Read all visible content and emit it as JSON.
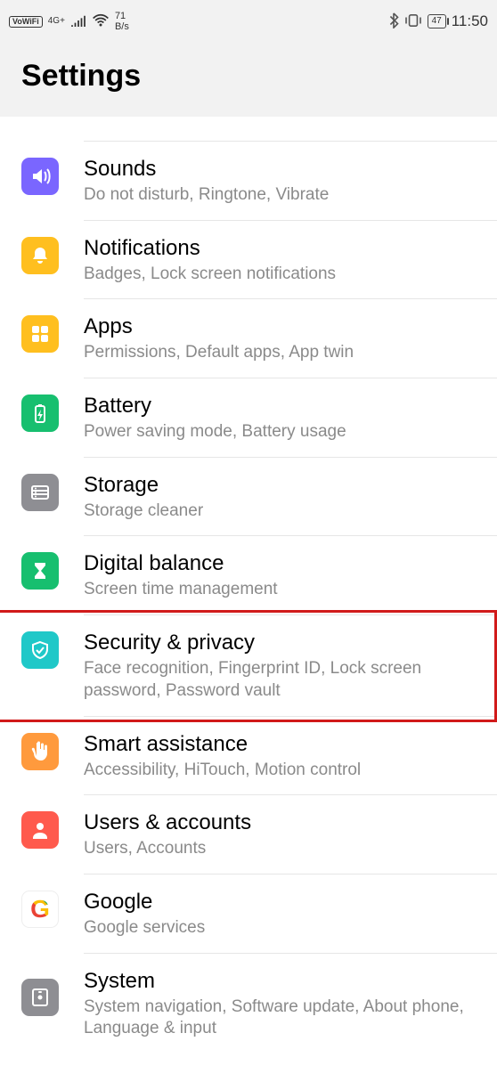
{
  "status": {
    "vowifi": "VoWiFi",
    "net": "4G+",
    "rate_top": "71",
    "rate_bot": "B/s",
    "battery": "47",
    "time": "11:50"
  },
  "header": {
    "title": "Settings"
  },
  "items": {
    "sounds": {
      "title": "Sounds",
      "sub": "Do not disturb, Ringtone, Vibrate"
    },
    "notif": {
      "title": "Notifications",
      "sub": "Badges, Lock screen notifications"
    },
    "apps": {
      "title": "Apps",
      "sub": "Permissions, Default apps, App twin"
    },
    "battery": {
      "title": "Battery",
      "sub": "Power saving mode, Battery usage"
    },
    "storage": {
      "title": "Storage",
      "sub": "Storage cleaner"
    },
    "digbal": {
      "title": "Digital balance",
      "sub": "Screen time management"
    },
    "security": {
      "title": "Security & privacy",
      "sub": "Face recognition, Fingerprint ID, Lock screen password, Password vault"
    },
    "smart": {
      "title": "Smart assistance",
      "sub": "Accessibility, HiTouch, Motion control"
    },
    "users": {
      "title": "Users & accounts",
      "sub": "Users, Accounts"
    },
    "google": {
      "title": "Google",
      "sub": "Google services"
    },
    "system": {
      "title": "System",
      "sub": "System navigation, Software update, About phone, Language & input"
    }
  },
  "highlight": {
    "target": "security"
  }
}
